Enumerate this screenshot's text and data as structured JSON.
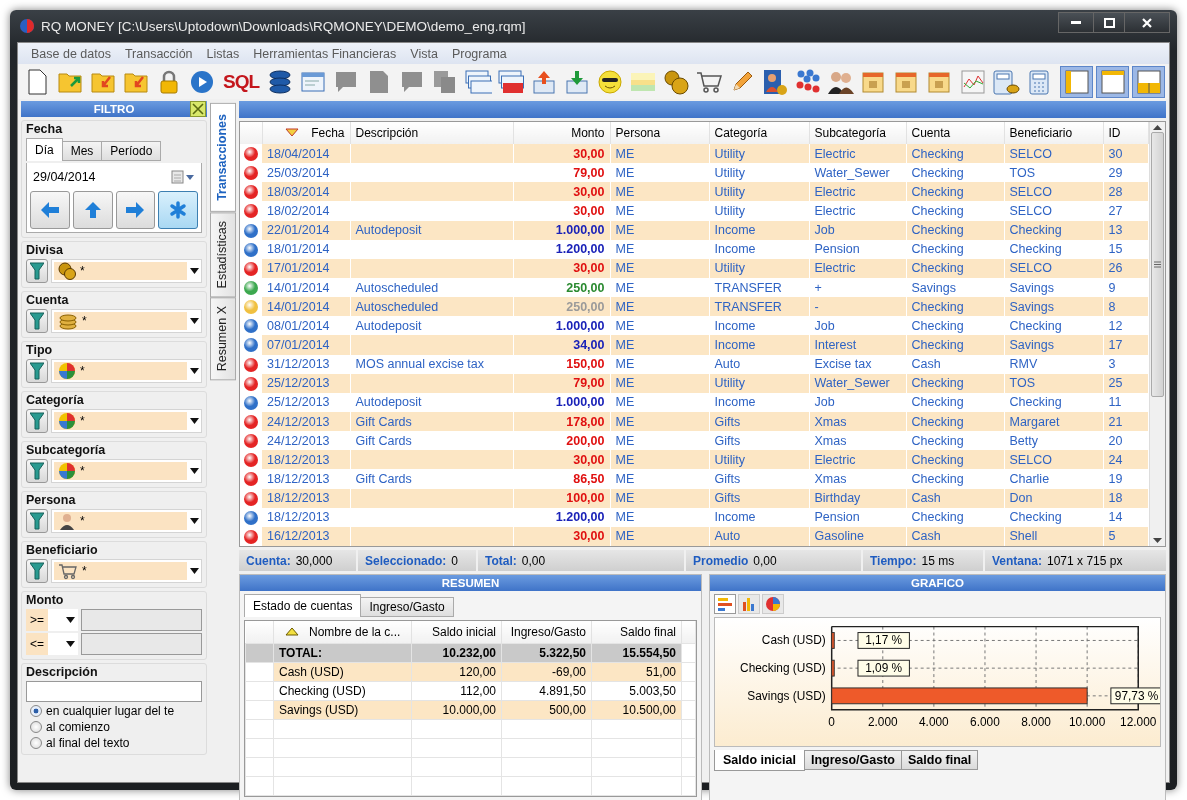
{
  "window": {
    "title": "RQ MONEY [C:\\Users\\Uptodown\\Downloads\\RQMONEY\\DEMO\\demo_eng.rqm]"
  },
  "menu": [
    "Base de datos",
    "Transacción",
    "Listas",
    "Herramientas Financieras",
    "Vista",
    "Programa"
  ],
  "toolbar": {
    "sql": "SQL"
  },
  "filter": {
    "title": "FILTRO",
    "date": {
      "label": "Fecha",
      "tabs": [
        {
          "label": "Día",
          "selected": true
        },
        {
          "label": "Mes",
          "selected": false
        },
        {
          "label": "Período",
          "selected": false
        }
      ],
      "value": "29/04/2014",
      "nav": [
        {
          "kind": "left",
          "selected": false
        },
        {
          "kind": "up",
          "selected": false
        },
        {
          "kind": "right",
          "selected": false
        },
        {
          "kind": "all",
          "selected": true
        }
      ]
    },
    "groups": [
      {
        "label": "Divisa",
        "kind": "coins",
        "value": "*"
      },
      {
        "label": "Cuenta",
        "kind": "stack",
        "value": "*"
      },
      {
        "label": "Tipo",
        "kind": "pie",
        "value": "*"
      },
      {
        "label": "Categoría",
        "kind": "pie",
        "value": "*"
      },
      {
        "label": "Subcategoría",
        "kind": "pie",
        "value": "*"
      },
      {
        "label": "Persona",
        "kind": "person",
        "value": "*"
      },
      {
        "label": "Beneficiario",
        "kind": "cart",
        "value": "*"
      }
    ],
    "amount": {
      "label": "Monto",
      "rows": [
        {
          "operator": ">="
        },
        {
          "operator": "<="
        }
      ]
    },
    "description": {
      "label": "Descripción",
      "options": [
        {
          "label": "en cualquier lugar del te",
          "selected": true
        },
        {
          "label": "al comienzo",
          "selected": false
        },
        {
          "label": "al final del texto",
          "selected": false
        }
      ]
    }
  },
  "side_tabs": [
    {
      "label": "Transacciones",
      "selected": true
    },
    {
      "label": "Estadísticas",
      "selected": false
    },
    {
      "label": "Resumen X",
      "selected": false
    }
  ],
  "transactions": {
    "columns": [
      {
        "label": "Fecha",
        "sorted_descending": true
      },
      {
        "label": "Descripción"
      },
      {
        "label": "Monto"
      },
      {
        "label": "Persona"
      },
      {
        "label": "Categoría"
      },
      {
        "label": "Subcategoría"
      },
      {
        "label": "Cuenta"
      },
      {
        "label": "Beneficiario"
      },
      {
        "label": "ID"
      }
    ],
    "rows": [
      {
        "kind": "expense",
        "date": "18/04/2014",
        "amount": "30,00",
        "person": "ME",
        "category": "Utility",
        "subcategory": "Electric",
        "account": "Checking",
        "payee": "SELCO",
        "id": "30"
      },
      {
        "kind": "expense",
        "date": "25/03/2014",
        "amount": "79,00",
        "person": "ME",
        "category": "Utility",
        "subcategory": "Water_Sewer",
        "account": "Checking",
        "payee": "TOS",
        "id": "29"
      },
      {
        "kind": "expense",
        "date": "18/03/2014",
        "amount": "30,00",
        "person": "ME",
        "category": "Utility",
        "subcategory": "Electric",
        "account": "Checking",
        "payee": "SELCO",
        "id": "28"
      },
      {
        "kind": "expense",
        "date": "18/02/2014",
        "amount": "30,00",
        "person": "ME",
        "category": "Utility",
        "subcategory": "Electric",
        "account": "Checking",
        "payee": "SELCO",
        "id": "27"
      },
      {
        "kind": "income",
        "date": "22/01/2014",
        "description": "Autodeposit",
        "amount": "1.000,00",
        "person": "ME",
        "category": "Income",
        "subcategory": "Job",
        "account": "Checking",
        "payee": "Checking",
        "id": "13"
      },
      {
        "kind": "income",
        "date": "18/01/2014",
        "amount": "1.200,00",
        "person": "ME",
        "category": "Income",
        "subcategory": "Pension",
        "account": "Checking",
        "payee": "Checking",
        "id": "15"
      },
      {
        "kind": "expense",
        "date": "17/01/2014",
        "amount": "30,00",
        "person": "ME",
        "category": "Utility",
        "subcategory": "Electric",
        "account": "Checking",
        "payee": "SELCO",
        "id": "26"
      },
      {
        "kind": "transfer_in",
        "date": "14/01/2014",
        "description": "Autoscheduled",
        "amount": "250,00",
        "person": "ME",
        "category": "TRANSFER",
        "subcategory": "+",
        "account": "Savings",
        "payee": "Savings",
        "id": "9"
      },
      {
        "kind": "transfer_out",
        "date": "14/01/2014",
        "description": "Autoscheduled",
        "amount": "250,00",
        "person": "ME",
        "category": "TRANSFER",
        "subcategory": "-",
        "account": "Checking",
        "payee": "Savings",
        "id": "8"
      },
      {
        "kind": "income",
        "date": "08/01/2014",
        "description": "Autodeposit",
        "amount": "1.000,00",
        "person": "ME",
        "category": "Income",
        "subcategory": "Job",
        "account": "Checking",
        "payee": "Checking",
        "id": "12"
      },
      {
        "kind": "income",
        "date": "07/01/2014",
        "amount": "34,00",
        "person": "ME",
        "category": "Income",
        "subcategory": "Interest",
        "account": "Checking",
        "payee": "Savings",
        "id": "17"
      },
      {
        "kind": "expense",
        "date": "31/12/2013",
        "description": "MOS annual excise tax",
        "amount": "150,00",
        "person": "ME",
        "category": "Auto",
        "subcategory": "Excise tax",
        "account": "Cash",
        "payee": "RMV",
        "id": "3"
      },
      {
        "kind": "expense",
        "date": "25/12/2013",
        "amount": "79,00",
        "person": "ME",
        "category": "Utility",
        "subcategory": "Water_Sewer",
        "account": "Checking",
        "payee": "TOS",
        "id": "25"
      },
      {
        "kind": "income",
        "date": "25/12/2013",
        "description": "Autodeposit",
        "amount": "1.000,00",
        "person": "ME",
        "category": "Income",
        "subcategory": "Job",
        "account": "Checking",
        "payee": "Checking",
        "id": "11"
      },
      {
        "kind": "expense",
        "date": "24/12/2013",
        "description": "Gift Cards",
        "amount": "178,00",
        "person": "ME",
        "category": "Gifts",
        "subcategory": "Xmas",
        "account": "Checking",
        "payee": "Margaret",
        "id": "21"
      },
      {
        "kind": "expense",
        "date": "24/12/2013",
        "description": "Gift Cards",
        "amount": "200,00",
        "person": "ME",
        "category": "Gifts",
        "subcategory": "Xmas",
        "account": "Checking",
        "payee": "Betty",
        "id": "20"
      },
      {
        "kind": "expense",
        "date": "18/12/2013",
        "amount": "30,00",
        "person": "ME",
        "category": "Utility",
        "subcategory": "Electric",
        "account": "Checking",
        "payee": "SELCO",
        "id": "24"
      },
      {
        "kind": "expense",
        "date": "18/12/2013",
        "description": "Gift Cards",
        "amount": "86,50",
        "person": "ME",
        "category": "Gifts",
        "subcategory": "Xmas",
        "account": "Checking",
        "payee": "Charlie",
        "id": "19"
      },
      {
        "kind": "expense",
        "date": "18/12/2013",
        "amount": "100,00",
        "person": "ME",
        "category": "Gifts",
        "subcategory": "Birthday",
        "account": "Cash",
        "payee": "Don",
        "id": "18"
      },
      {
        "kind": "income",
        "date": "18/12/2013",
        "amount": "1.200,00",
        "person": "ME",
        "category": "Income",
        "subcategory": "Pension",
        "account": "Checking",
        "payee": "Checking",
        "id": "14"
      },
      {
        "kind": "expense",
        "date": "16/12/2013",
        "amount": "30,00",
        "person": "ME",
        "category": "Auto",
        "subcategory": "Gasoline",
        "account": "Cash",
        "payee": "Shell",
        "id": "5"
      }
    ]
  },
  "status_bar": [
    {
      "label": "Cuenta:",
      "value": "30,000"
    },
    {
      "label": "Seleccionado:",
      "value": "0"
    },
    {
      "label": "Total:",
      "value": "0,00"
    },
    {
      "label": "Promedio",
      "value": "0,00"
    },
    {
      "label": "Tiempo:",
      "value": "15 ms"
    },
    {
      "label": "Ventana:",
      "value": "1071 x 715 px"
    }
  ],
  "summary": {
    "title": "RESUMEN",
    "tabs": [
      {
        "label": "Estado de cuentas",
        "selected": true
      },
      {
        "label": "Ingreso/Gasto",
        "selected": false
      }
    ],
    "columns": [
      {
        "label": "Nombre de la c...",
        "sorted_ascending": true
      },
      {
        "label": "Saldo inicial"
      },
      {
        "label": "Ingreso/Gasto"
      },
      {
        "label": "Saldo final"
      }
    ],
    "rows": [
      {
        "kind": "total",
        "cells": [
          "TOTAL:",
          "10.232,00",
          "5.322,50",
          "15.554,50"
        ]
      },
      {
        "kind": "account",
        "cells": [
          "Cash (USD)",
          "120,00",
          "-69,00",
          "51,00"
        ]
      },
      {
        "kind": "account",
        "cells": [
          "Checking (USD)",
          "112,00",
          "4.891,50",
          "5.003,50"
        ]
      },
      {
        "kind": "account",
        "cells": [
          "Savings (USD)",
          "10.000,00",
          "500,00",
          "10.500,00"
        ]
      }
    ]
  },
  "chart": {
    "title": "GRAFICO",
    "views": [
      {
        "kind": "hbar",
        "selected": true
      },
      {
        "kind": "vbar",
        "selected": false
      },
      {
        "kind": "pie",
        "selected": false
      }
    ],
    "chart_data": {
      "type": "bar",
      "orientation": "horizontal",
      "grid": true,
      "categories": [
        "Cash (USD)",
        "Checking (USD)",
        "Savings (USD)"
      ],
      "series": [
        {
          "color": "#ee5a2a",
          "values": [
            100,
            100,
            10000
          ]
        }
      ],
      "xlim": [
        0,
        12000
      ],
      "xticks": [
        {
          "value": 0,
          "label": "0"
        },
        {
          "value": 2000,
          "label": "2.000"
        },
        {
          "value": 4000,
          "label": "4.000"
        },
        {
          "value": 6000,
          "label": "6.000"
        },
        {
          "value": 8000,
          "label": "8.000"
        },
        {
          "value": 10000,
          "label": "10.000"
        },
        {
          "value": 12000,
          "label": "12.000"
        }
      ],
      "value_labels": [
        "1,17 %",
        "1,09 %",
        "97,73 %"
      ]
    },
    "tabs": [
      {
        "label": "Saldo inicial",
        "selected": true
      },
      {
        "label": "Ingreso/Gasto",
        "selected": false
      },
      {
        "label": "Saldo final",
        "selected": false
      }
    ]
  }
}
